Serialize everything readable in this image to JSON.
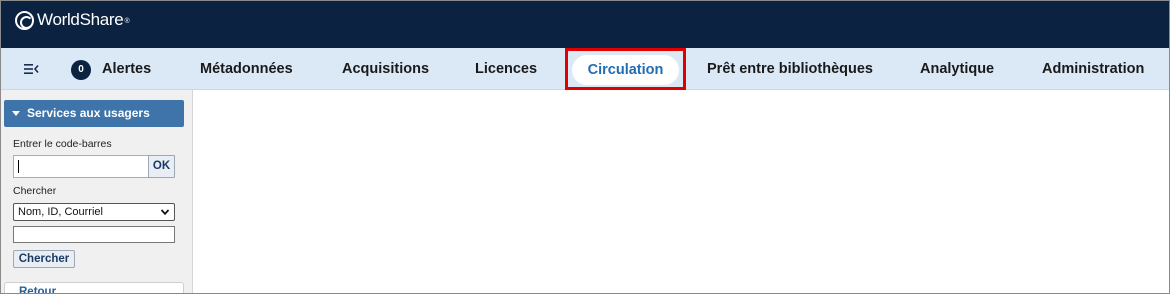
{
  "header": {
    "logo_text": "WorldShare",
    "logo_tm": "®"
  },
  "nav": {
    "alerts_count": "0",
    "items": [
      {
        "label": "Alertes"
      },
      {
        "label": "Métadonnées"
      },
      {
        "label": "Acquisitions"
      },
      {
        "label": "Licences"
      },
      {
        "label": "Circulation",
        "active": true
      },
      {
        "label": "Prêt entre bibliothèques"
      },
      {
        "label": "Analytique"
      },
      {
        "label": "Administration"
      }
    ],
    "active_color": "#1f6db2",
    "highlight_color": "#e00000"
  },
  "sidebar": {
    "panel_title": "Services aux usagers",
    "barcode_label": "Entrer le code-barres",
    "barcode_value": "",
    "ok_label": "OK",
    "search_label": "Chercher",
    "search_type_selected": "Nom, ID, Courriel",
    "search_value": "",
    "search_button": "Chercher",
    "back_label": "Retour"
  }
}
